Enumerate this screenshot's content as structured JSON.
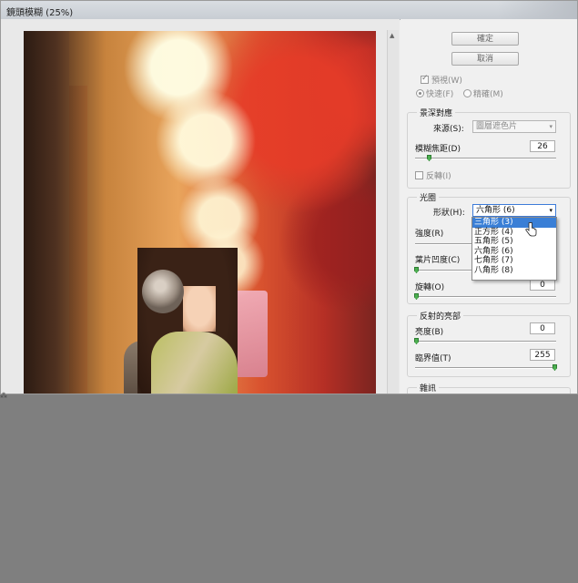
{
  "window": {
    "title": "鏡頭模糊 (25%)"
  },
  "buttons": {
    "ok": "確定",
    "cancel": "取消"
  },
  "preview_options": {
    "preview_label": "預視(W)",
    "preview_checked": true,
    "fast_label": "快速(F)",
    "accurate_label": "精確(M)",
    "selected_mode": "fast"
  },
  "depth_map": {
    "title": "景深對應",
    "source_label": "來源(S):",
    "source_value": "圖層遮色片",
    "blur_focal_label": "模糊焦距(D)",
    "blur_focal_value": "26",
    "invert_label": "反轉(I)",
    "invert_checked": false
  },
  "iris": {
    "title": "光圈",
    "shape_label": "形狀(H):",
    "shape_value": "六角形 (6)",
    "radius_label": "強度(R)",
    "blade_label": "葉片凹度(C)",
    "rotation_label": "旋轉(O)",
    "rotation_value": "0",
    "shape_options": [
      "三角形 (3)",
      "正方形 (4)",
      "五角形 (5)",
      "六角形 (6)",
      "七角形 (7)",
      "八角形 (8)"
    ],
    "highlighted_option": 0
  },
  "specular": {
    "title": "反射的亮部",
    "brightness_label": "亮度(B)",
    "brightness_value": "0",
    "threshold_label": "臨界值(T)",
    "threshold_value": "255"
  },
  "noise": {
    "title": "雜訊"
  },
  "colors": {
    "accent": "#3a7fd6",
    "slider_thumb": "#4caf50",
    "background": "#7f7f7f"
  }
}
